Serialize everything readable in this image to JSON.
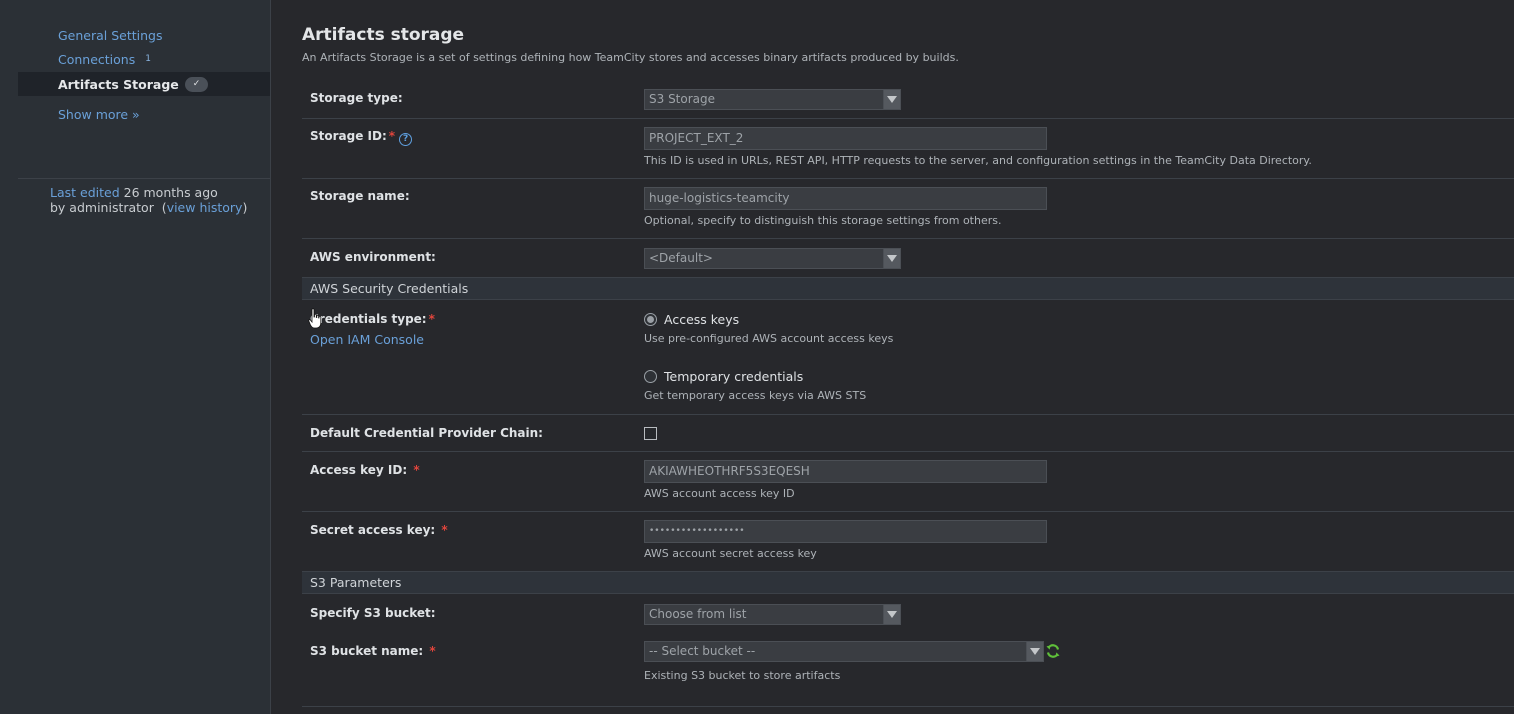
{
  "sidebar": {
    "items": [
      {
        "label": "General Settings"
      },
      {
        "label": "Connections",
        "count": "1"
      },
      {
        "label": "Artifacts Storage",
        "badge": "✓"
      }
    ],
    "show_more": "Show more »",
    "last_edited_prefix": "Last edited",
    "last_edited_when": "26 months ago",
    "by_line": "by administrator",
    "view_history": "view history"
  },
  "page": {
    "title": "Artifacts storage",
    "description": "An Artifacts Storage is a set of settings defining how TeamCity stores and accesses binary artifacts produced by builds."
  },
  "form": {
    "storage_type": {
      "label": "Storage type:",
      "value": "S3 Storage"
    },
    "storage_id": {
      "label": "Storage ID:",
      "value": "PROJECT_EXT_2",
      "hint": "This ID is used in URLs, REST API, HTTP requests to the server, and configuration settings in the TeamCity Data Directory."
    },
    "storage_name": {
      "label": "Storage name:",
      "value": "huge-logistics-teamcity",
      "hint": "Optional, specify to distinguish this storage settings from others."
    },
    "aws_environment": {
      "label": "AWS environment:",
      "value": "<Default>"
    },
    "section_credentials": "AWS Security Credentials",
    "credentials_type": {
      "label": "Credentials type:",
      "iam_link": "Open IAM Console",
      "options": [
        {
          "label": "Access keys",
          "hint": "Use pre-configured AWS account access keys",
          "selected": true
        },
        {
          "label": "Temporary credentials",
          "hint": "Get temporary access keys via AWS STS",
          "selected": false
        }
      ]
    },
    "default_chain": {
      "label": "Default Credential Provider Chain:",
      "checked": false
    },
    "access_key_id": {
      "label": "Access key ID:",
      "value": "AKIAWHEOTHRF5S3EQESH",
      "hint": "AWS account access key ID"
    },
    "secret_access_key": {
      "label": "Secret access key:",
      "value": "••••••••••••••••••",
      "hint": "AWS account secret access key"
    },
    "section_s3": "S3 Parameters",
    "specify_bucket": {
      "label": "Specify S3 bucket:",
      "value": "Choose from list"
    },
    "bucket_name": {
      "label": "S3 bucket name:",
      "value": "-- Select bucket --",
      "hint": "Existing S3 bucket to store artifacts"
    }
  },
  "colors": {
    "background": "#27282c",
    "sidebar": "#2b3036",
    "link": "#6aa0d8",
    "required": "#e0453c",
    "refresh": "#5fbf3a"
  }
}
